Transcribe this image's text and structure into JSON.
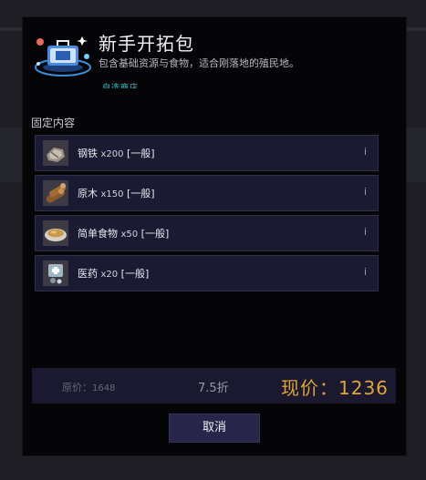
{
  "pack": {
    "title": "新手开拓包",
    "subtitle": "包含基础资源与食物，适合刚落地的殖民地。",
    "tagline": "自选商店"
  },
  "fixed_contents": {
    "label": "固定内容",
    "items": [
      {
        "name": "钢铁",
        "qty": "x200",
        "grade": "[一般]",
        "icon": "steel-icon",
        "info": "i"
      },
      {
        "name": "原木",
        "qty": "x150",
        "grade": "[一般]",
        "icon": "wood-log-icon",
        "info": "i"
      },
      {
        "name": "简单食物",
        "qty": "x50",
        "grade": "[一般]",
        "icon": "simple-meal-icon",
        "info": "i"
      },
      {
        "name": "医药",
        "qty": "x20",
        "grade": "[一般]",
        "icon": "medicine-icon",
        "info": "i"
      }
    ]
  },
  "price": {
    "original_label": "原价：",
    "original_value": "1648",
    "discount": "7.5折",
    "current_label": "现价：",
    "current_value": "1236"
  },
  "buttons": {
    "cancel": "取消"
  },
  "colors": {
    "accent_gold": "#e0a43a",
    "item_bg": "#1b1a33",
    "tagline_cyan": "#35c5c7"
  }
}
